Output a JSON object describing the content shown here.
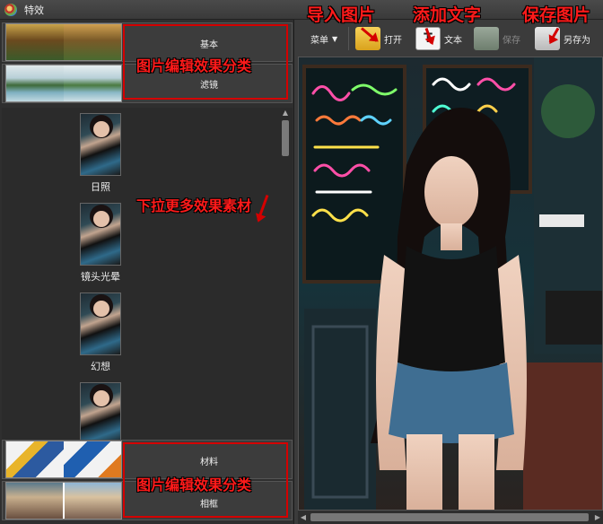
{
  "window": {
    "title": "特效"
  },
  "categories": {
    "top_label_1": "基本",
    "top_label_2": "滤镜",
    "bottom_label_1": "材料",
    "bottom_label_2": "相框"
  },
  "effects": [
    {
      "label": "日照"
    },
    {
      "label": "镜头光晕"
    },
    {
      "label": "幻想"
    },
    {
      "label": ""
    }
  ],
  "toolbar": {
    "menu_label": "菜单",
    "open_label": "打开",
    "text_label": "文本",
    "save_label": "保存",
    "saveas_label": "另存为"
  },
  "annotations": {
    "import_image": "导入图片",
    "add_text": "添加文字",
    "save_image": "保存图片",
    "category_top": "图片编辑效果分类",
    "category_bottom": "图片编辑效果分类",
    "pull_more": "下拉更多效果素材"
  },
  "colors": {
    "annotation_red": "#d40000",
    "background": "#3b3b3b"
  }
}
